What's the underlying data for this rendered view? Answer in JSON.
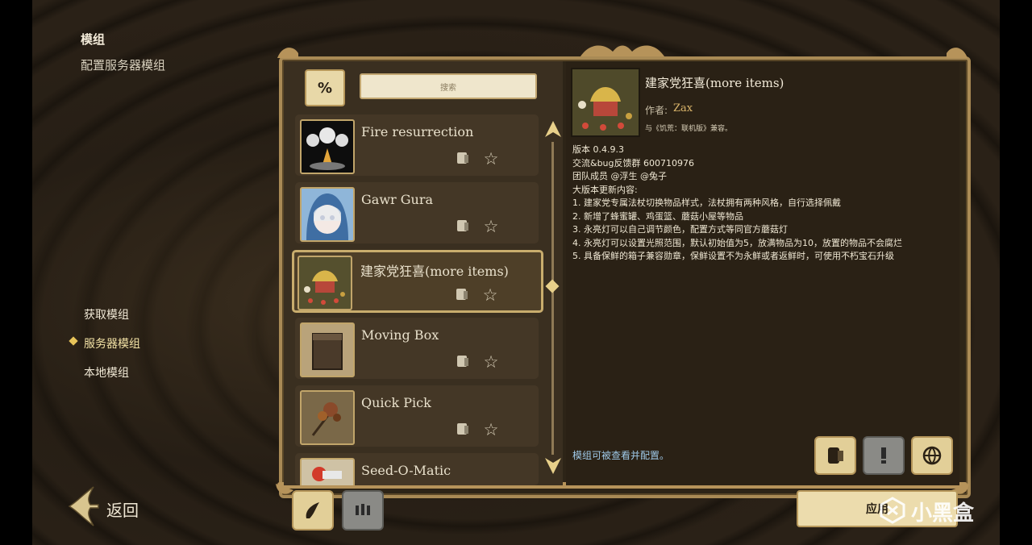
{
  "header": {
    "title": "模组",
    "subtitle": "配置服务器模组"
  },
  "nav": {
    "items": [
      {
        "label": "获取模组",
        "active": false
      },
      {
        "label": "服务器模组",
        "active": true
      },
      {
        "label": "本地模组",
        "active": false
      }
    ]
  },
  "back": {
    "label": "返回"
  },
  "search": {
    "placeholder": "搜索"
  },
  "filter": {
    "label": "%"
  },
  "mods": [
    {
      "name": "Fire resurrection"
    },
    {
      "name": "Gawr Gura"
    },
    {
      "name": "建家党狂喜(more items)"
    },
    {
      "name": "Moving Box"
    },
    {
      "name": "Quick Pick"
    },
    {
      "name": "Seed-O-Matic"
    }
  ],
  "detail": {
    "title": "建家党狂喜(more items)",
    "author_label": "作者:",
    "author": "Zax",
    "compat": "与《饥荒：联机版》兼容。",
    "lines": [
      "版本 0.4.9.3",
      "交流&bug反馈群 600710976",
      "团队成员 @浮生 @兔子",
      "大版本更新内容:",
      "1. 建家党专属法杖切换物品样式，法杖拥有两种风格，自行选择佩戴",
      "2. 新增了蜂蜜罐、鸡蛋篮、蘑菇小屋等物品",
      "3. 永亮灯可以自己调节颜色，配置方式等同官方蘑菇灯",
      "4. 永亮灯可以设置光照范围，默认初始值为5，放满物品为10，放置的物品不会腐烂",
      "5. 具备保鲜的箱子兼容勋章，保鲜设置不为永鲜或者返鲜时，可使用不朽宝石升级"
    ],
    "config_note": "模组可被查看并配置。"
  },
  "apply": {
    "label": "应用"
  },
  "watermark": {
    "text": "小黑盒"
  },
  "colors": {
    "accent": "#e8d8a8",
    "frame": "#a98a55",
    "link": "#9fc9e8"
  }
}
